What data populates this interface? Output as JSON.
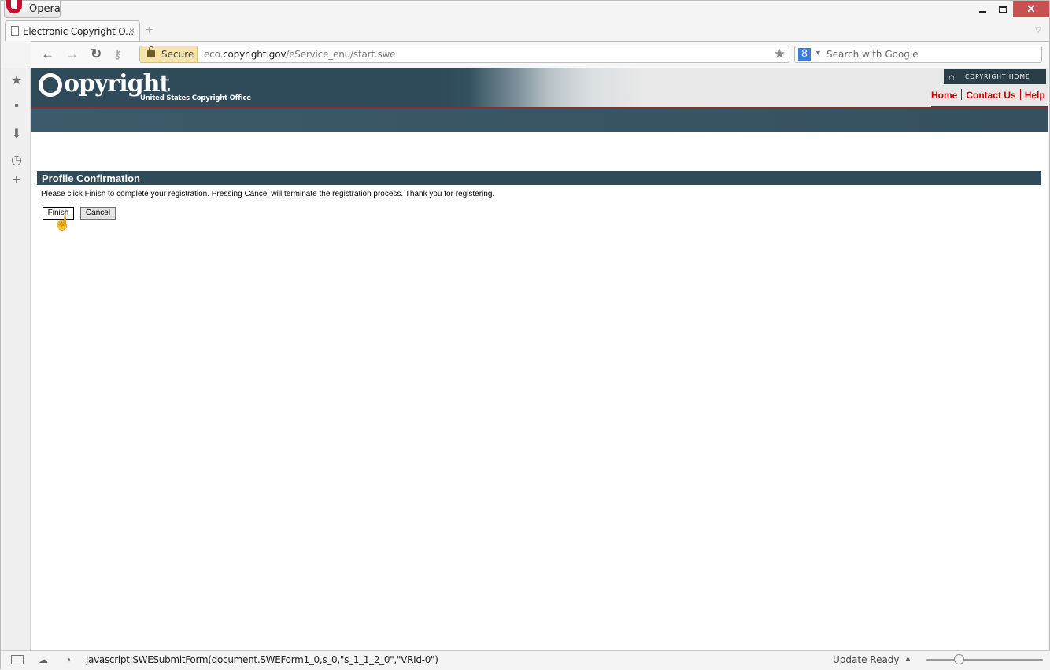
{
  "browser": {
    "menu_label": "Opera",
    "tab": {
      "title": "Electronic Copyright O...",
      "close": "×"
    },
    "new_tab": "+",
    "address": {
      "secure_label": "Secure",
      "url_prefix": "eco.",
      "url_domain": "copyright.gov",
      "url_path": "/eService_enu/start.swe"
    },
    "search": {
      "engine_icon": "8",
      "placeholder": "Search with Google"
    },
    "window_controls": {
      "close": "✕"
    }
  },
  "sidebar": {
    "items": [
      {
        "name": "bookmarks",
        "icon": "★"
      },
      {
        "name": "notes",
        "icon": "▪"
      },
      {
        "name": "downloads",
        "icon": "⬇"
      },
      {
        "name": "history",
        "icon": "◷"
      },
      {
        "name": "add-panel",
        "icon": "+"
      }
    ]
  },
  "site": {
    "logo_text": "opyright",
    "logo_subtitle": "United States Copyright Office",
    "copyright_home": "COPYRIGHT HOME",
    "nav_links": [
      "Home",
      "Contact Us",
      "Help"
    ],
    "colors": {
      "banner": "#2f4a58",
      "link_red": "#cc0000",
      "accent_line": "#8b2d35"
    }
  },
  "main": {
    "section_title": "Profile Confirmation",
    "instructions": "Please click Finish to complete your registration. Pressing Cancel will terminate the registration process. Thank you for registering.",
    "finish_label": "Finish",
    "cancel_label": "Cancel"
  },
  "statusbar": {
    "link_preview": "javascript:SWESubmitForm(document.SWEForm1_0,s_0,\"s_1_1_2_0\",\"VRId-0\")",
    "update_status": "Update Ready",
    "zoom_level_fraction": 0.28
  }
}
